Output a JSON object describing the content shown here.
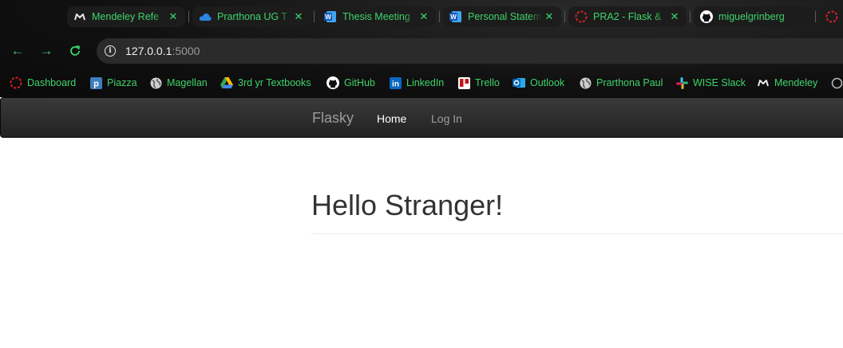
{
  "browser": {
    "tabs": [
      {
        "title": "Mendeley Refe",
        "icon": "mendeley-icon"
      },
      {
        "title": "Prarthona UG T",
        "icon": "onedrive-icon"
      },
      {
        "title": "Thesis Meeting",
        "icon": "word-icon"
      },
      {
        "title": "Personal Statem",
        "icon": "word-icon"
      },
      {
        "title": "PRA2 - Flask &",
        "icon": "dashed-circle-icon"
      },
      {
        "title": "miguelgrinberg",
        "icon": "github-icon"
      }
    ],
    "address": {
      "host": "127.0.0.1",
      "port": ":5000"
    },
    "bookmarks": [
      {
        "label": "Dashboard",
        "icon": "dashed-circle-icon"
      },
      {
        "label": "Piazza",
        "icon": "piazza-icon"
      },
      {
        "label": "Magellan",
        "icon": "globe-icon"
      },
      {
        "label": "3rd yr Textbooks",
        "icon": "google-drive-icon"
      },
      {
        "label": "GitHub",
        "icon": "github-icon"
      },
      {
        "label": "LinkedIn",
        "icon": "linkedin-icon"
      },
      {
        "label": "Trello",
        "icon": "trello-icon"
      },
      {
        "label": "Outlook",
        "icon": "outlook-icon"
      },
      {
        "label": "Prarthona Paul",
        "icon": "globe-icon"
      },
      {
        "label": "WISE Slack",
        "icon": "slack-icon"
      },
      {
        "label": "Mendeley",
        "icon": "mendeley-icon"
      }
    ],
    "accent": "#3fd46a"
  },
  "navbar": {
    "brand": "Flasky",
    "links": [
      "Home",
      "Log In"
    ]
  },
  "page": {
    "heading": "Hello Stranger!"
  }
}
